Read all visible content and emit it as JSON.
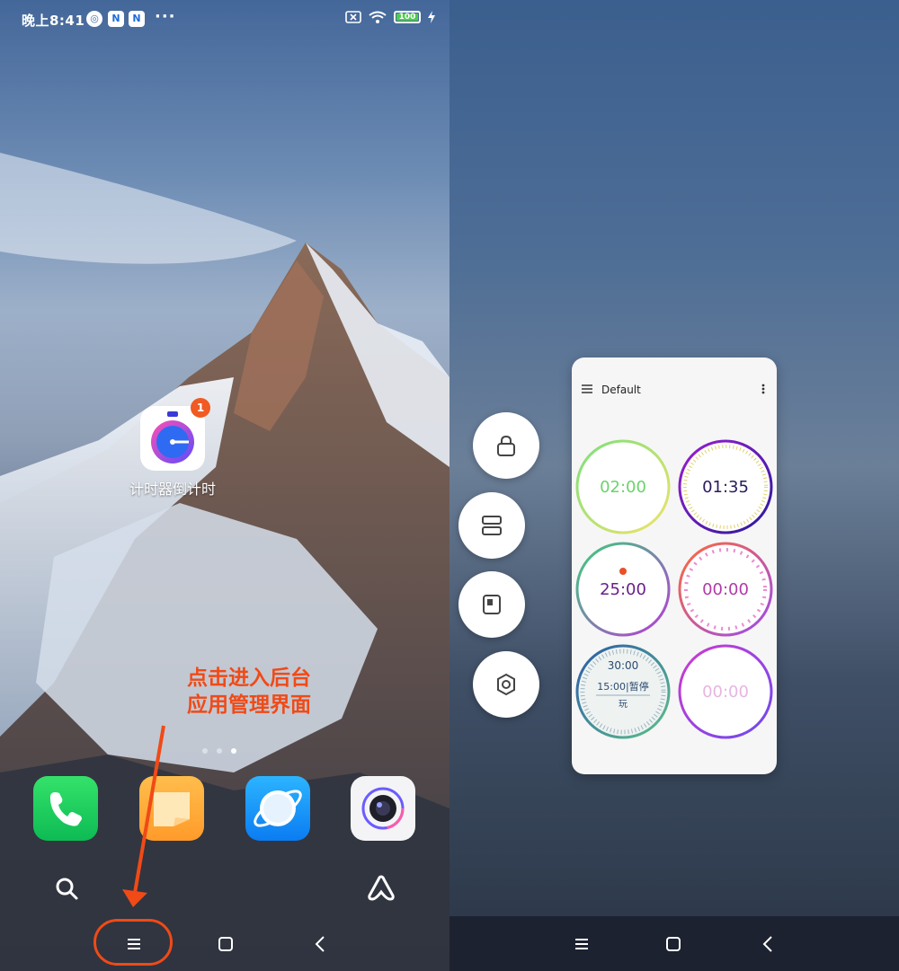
{
  "left": {
    "status": {
      "time": "晚上8:41",
      "battery": "100"
    },
    "home_app": {
      "label": "计时器倒计时",
      "badge": "1"
    },
    "annotation": {
      "line1": "点击进入后台",
      "line2": "应用管理界面"
    }
  },
  "right": {
    "card": {
      "title": "Default",
      "timers": [
        {
          "text": "02:00",
          "color": "#6bd36b"
        },
        {
          "text": "01:35",
          "color": "#2a1a5e"
        },
        {
          "text": "25:00",
          "color": "#6a1f8c"
        },
        {
          "text": "00:00",
          "color": "#b03aa8"
        },
        {
          "text": "30:00",
          "sub": "15:00",
          "sub2": "暂停",
          "sub3": "玩",
          "color": "#2c4a6e"
        },
        {
          "text": "00:00",
          "color": "#e6b6e0"
        }
      ]
    }
  },
  "colors": {
    "accent": "#f04a17",
    "badge": "#f05a23"
  }
}
